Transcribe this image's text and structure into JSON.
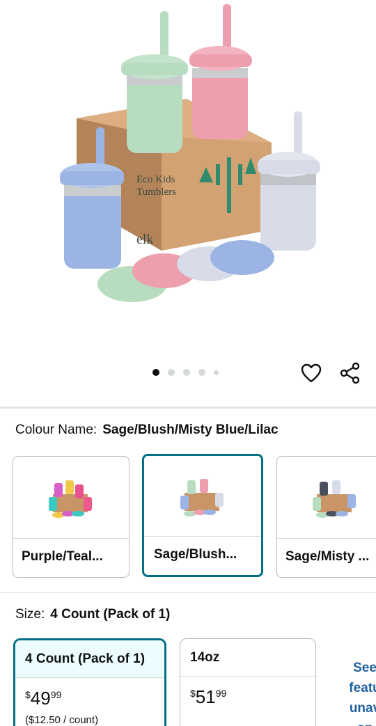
{
  "gallery": {
    "image_alt": "Eco Kids Tumblers",
    "box_text_line1": "Eco Kids",
    "box_text_line2": "Tumblers",
    "brand": "elk",
    "dots_count": 5,
    "active_dot": 0
  },
  "colour": {
    "label": "Colour Name:",
    "selected_value": "Sage/Blush/Misty Blue/Lilac",
    "options": [
      {
        "name": "Purple/Teal..."
      },
      {
        "name": "Sage/Blush..."
      },
      {
        "name": "Sage/Misty ..."
      }
    ],
    "selected_index": 1
  },
  "size": {
    "label": "Size:",
    "selected_value": "4 Count (Pack of 1)",
    "options": [
      {
        "title": "4 Count (Pack of 1)",
        "price_symbol": "$",
        "price_whole": "49",
        "price_cents": "99",
        "unit_price": "($12.50 / count)"
      },
      {
        "title": "14oz",
        "price_symbol": "$",
        "price_whole": "51",
        "price_cents": "99"
      }
    ],
    "see_more_lines": [
      "See",
      "featu",
      "unav",
      "op"
    ]
  },
  "colors": {
    "accent": "#007185",
    "link": "#2162a1",
    "sage": "#b7dcc0",
    "blush": "#ee9fad",
    "misty_blue": "#9bb4e4",
    "lilac": "#d8dbe8"
  },
  "icons": {
    "wishlist": "heart-icon",
    "share": "share-icon"
  }
}
